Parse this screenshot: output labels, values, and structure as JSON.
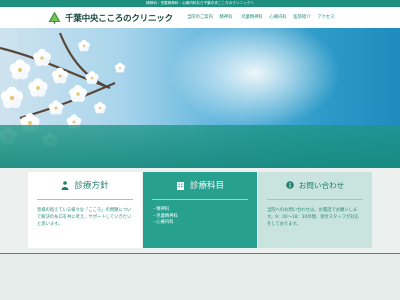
{
  "topbar": {
    "text": "精神科・児童精神科・心療内科なら千葉中央こころのクリニックへ"
  },
  "header": {
    "logo_text": "千葉中央こころのクリニック",
    "logo_icon": "tree-logo-icon"
  },
  "nav": {
    "items": [
      {
        "label": "当院のご案内"
      },
      {
        "label": "精神科"
      },
      {
        "label": "児童精神科"
      },
      {
        "label": "心療内科"
      },
      {
        "label": "医院紹介"
      },
      {
        "label": "アクセス"
      }
    ]
  },
  "cards": {
    "policy": {
      "title": "診療方針",
      "icon": "person-icon",
      "text": "皆様の抱えている様々な「こころ」の問題について解決の糸口を共に考え、サポートしていきたいと思います。"
    },
    "departments": {
      "title": "診療科目",
      "icon": "building-icon",
      "items": [
        "精神科",
        "児童精神科",
        "心療内科"
      ]
    },
    "contact": {
      "title": "お問い合わせ",
      "icon": "info-icon",
      "text": "当院へのお問い合わせは、お電話でお願いします。9：00～18：30の間、受付スタッフが対応をしております。"
    }
  },
  "colors": {
    "brand": "#1e8f7e",
    "card_green": "#27a08f",
    "card_pale": "#c9e4de"
  }
}
